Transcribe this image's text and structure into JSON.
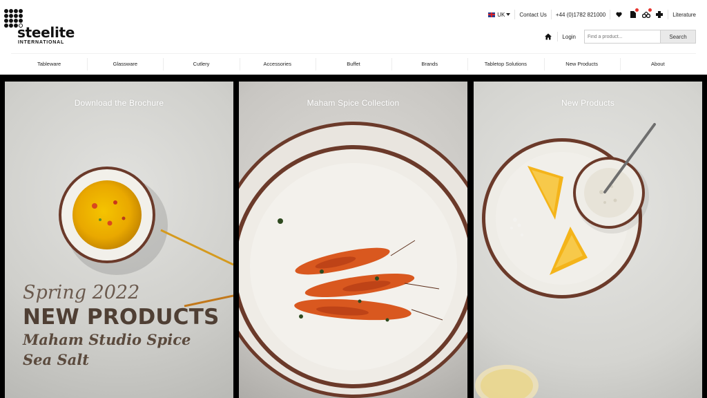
{
  "brand": {
    "name": "steelite",
    "subtitle": "INTERNATIONAL"
  },
  "utility": {
    "region": "UK",
    "contact": "Contact Us",
    "phone": "+44 (0)1782 821000",
    "literature": "Literature",
    "icons": [
      "heart-icon",
      "document-icon",
      "compare-icon",
      "basket-icon"
    ]
  },
  "account": {
    "login": "Login",
    "search_placeholder": "Find a product...",
    "search_button": "Search"
  },
  "nav": {
    "items": [
      {
        "label": "Tableware"
      },
      {
        "label": "Glassware"
      },
      {
        "label": "Cutlery"
      },
      {
        "label": "Accessories"
      },
      {
        "label": "Buffet"
      },
      {
        "label": "Brands"
      },
      {
        "label": "Tabletop Solutions"
      },
      {
        "label": "New Products"
      },
      {
        "label": "About"
      }
    ]
  },
  "hero": {
    "panels": [
      {
        "title": "Download the Brochure"
      },
      {
        "title": "Maham Spice Collection"
      },
      {
        "title": "New Products"
      }
    ],
    "promo": {
      "line1": "Spring 2022",
      "line2": "NEW PRODUCTS",
      "line3": "Maham Studio Spice",
      "line4": "Sea Salt"
    }
  },
  "colors": {
    "accent_dot": "#e8342e",
    "promo_brown": "#4f3f34",
    "plate_rim": "#6b3a2a"
  }
}
